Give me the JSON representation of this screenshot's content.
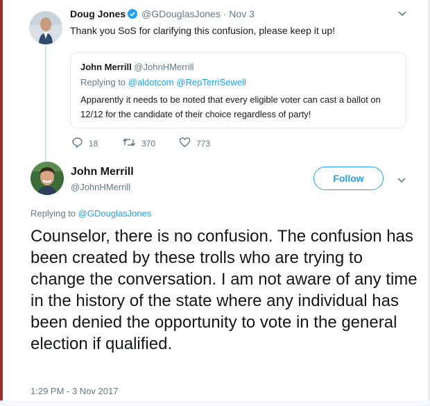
{
  "parent_tweet": {
    "author_name": "Doug Jones",
    "author_handle": "@GDouglasJones",
    "separator": "·",
    "date": "Nov 3",
    "text": "Thank you SoS for clarifying this confusion, please keep it up!",
    "quoted_tweet": {
      "author_name": "John Merrill",
      "author_handle": "@JohnHMerrill",
      "replying_to_label": "Replying to",
      "replying_to_1": "@aldotcom",
      "replying_to_2": "@RepTerriSewell",
      "text": "Apparently it needs to be noted that every eligible voter can cast a ballot on 12/12 for the candidate of their choice regardless of party!"
    },
    "reply_count": "18",
    "retweet_count": "370",
    "like_count": "773"
  },
  "main_tweet": {
    "author_name": "John Merrill",
    "author_handle": "@JohnHMerrill",
    "follow_label": "Follow",
    "replying_to_label": "Replying to",
    "replying_to": "@GDouglasJones",
    "text": "Counselor, there is no confusion. The confusion has been created by these trolls who are trying to change the conversation. I am not aware of any time in the history of the state where any individual has been denied the opportunity to vote in the general election if qualified.",
    "timestamp": "1:29 PM - 3 Nov 2017"
  },
  "colors": {
    "accent": "#1da1f2",
    "muted_text": "#657786",
    "thread_line": "#cce3f3"
  }
}
